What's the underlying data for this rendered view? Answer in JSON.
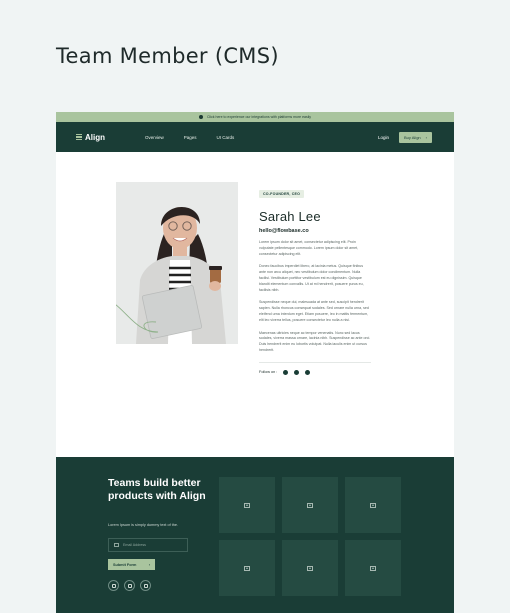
{
  "page": {
    "title": "Team Member (CMS)"
  },
  "announcement": {
    "text": "Click here to experience our integrations with platforms more easily"
  },
  "nav": {
    "logo": "Align",
    "links": [
      "Overview",
      "Pages",
      "UI Cards"
    ],
    "login": "Login",
    "buy": "Buy Align",
    "buy_arrow": "›"
  },
  "profile": {
    "role": "CO-FOUNDER, CEO",
    "name": "Sarah Lee",
    "email": "hello@flowbase.co",
    "bio": [
      "Lorem ipsum dolor sit amet, consectetur adipiscing elit. Proin vulputate pellentesque commodo. Lorem ipsum dolor sit amet, consectetur adipiscing elit.",
      "Donec faucibus imperdiet libero, at lacinia metus. Quisque finibus ante non arcu aliquet, nec vestibulum dolor condimentum. Nulla facilisi. Vestibulum porttitor vestibulum est eu dignissim. Quisque blandit elementum convallis. Ut at mi hendrerit, posuere purus eu, facilisis nibh.",
      "Suspendisse neque dui, malesuada at ante sed, suscipit hendrerit sapien. Nulla rhoncus consequat sodales. Sed ornare nulla urna, sed eleifend urna interdum eget. Etiam posuere, leo in mattis fermentum, elit leo viverra tellus, posuere consectetur leo nulla a nisi.",
      "Maecenas ultricies neque ac tempor venenatis. Nunc sed lacus sodales, viverra massa ornare, lacinia nibh. Suspendisse ac ante orci. Duis hendrerit enim eu lobortis volutpat. Nulla iaculis enim ut cursus hendrerit."
    ],
    "follow_label": "Follow on :",
    "social_icons": [
      "facebook-icon",
      "instagram-icon",
      "twitter-icon"
    ]
  },
  "footer": {
    "title": "Teams build better products with Align",
    "subtitle": "Lorem Ipsum is simply dummy text of the.",
    "email_placeholder": "Email Address",
    "submit": "Submit Form",
    "submit_arrow": "›",
    "social_icons": [
      "facebook-icon",
      "twitter-icon",
      "instagram-icon"
    ],
    "gallery_count": 6
  },
  "colors": {
    "primary": "#1a3d36",
    "accent": "#a9c49e",
    "background": "#f0f4f4"
  }
}
